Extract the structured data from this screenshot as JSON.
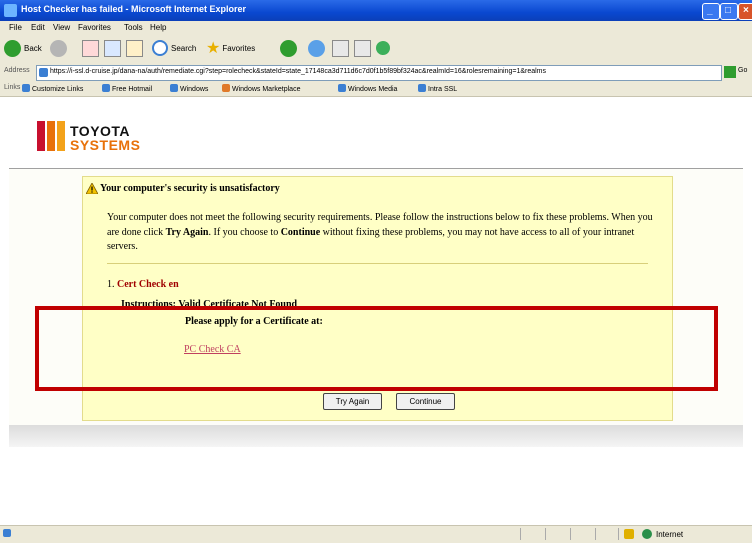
{
  "window": {
    "title": "Host Checker has failed - Microsoft Internet Explorer"
  },
  "menu": {
    "file": "File",
    "edit": "Edit",
    "view": "View",
    "favorites": "Favorites",
    "tools": "Tools",
    "help": "Help"
  },
  "toolbar": {
    "back": "Back",
    "search": "Search",
    "favorites": "Favorites"
  },
  "address": {
    "label": "Address",
    "url": "https://i-ssl.d-cruise.jp/dana-na/auth/remediate.cgi?step=rolecheck&stateId=state_17148ca3d711d6c7d0f1b5f89bf324ac&realmId=16&rolesremaining=1&realms",
    "go": "Go"
  },
  "links": {
    "label": "Links",
    "items": [
      "Customize Links",
      "Free Hotmail",
      "Windows",
      "Windows Marketplace",
      "Windows Media",
      "Intra SSL"
    ]
  },
  "logo": {
    "line1": "TOYOTA",
    "line2": "SYSTEMS"
  },
  "notice": {
    "heading": "Your computer's security is unsatisfactory",
    "para_1": "Your computer does not meet the following security requirements. Please follow the instructions below to fix these problems. When you are done click ",
    "try_again_bold": "Try Again",
    "para_2": ". If you choose to ",
    "continue_bold": "Continue",
    "para_3": " without fixing these problems, you may not have access to all of your intranet servers.",
    "item_number": "1.",
    "item_title": "Cert Check en",
    "obscured_line": "Instructions: Valid Certificate Not Found",
    "apply_text": "Please apply for a Certificate at:",
    "link_text": "PC Check CA"
  },
  "buttons": {
    "try_again": "Try Again",
    "continue": "Continue"
  },
  "status": {
    "zone": "Internet"
  },
  "colors": {
    "highlight_box": "#c00000",
    "notice_bg": "#ffffc6",
    "logo_orange": "#e8710a",
    "link": "#c04060"
  }
}
